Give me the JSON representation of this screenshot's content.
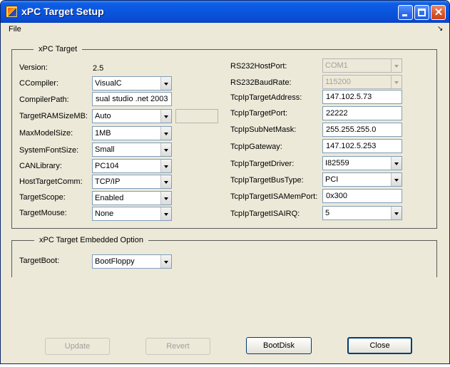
{
  "window": {
    "title": "xPC Target Setup"
  },
  "menu": {
    "file": "File",
    "overflow": "↘"
  },
  "main_group": {
    "title": "xPC Target",
    "left": {
      "version_label": "Version:",
      "version_value": "2.5",
      "ccompiler_label": "CCompiler:",
      "ccompiler_value": "VisualC",
      "compilerpath_label": "CompilerPath:",
      "compilerpath_value": "sual studio .net 2003",
      "ramsize_label": "TargetRAMSizeMB:",
      "ramsize_value": "Auto",
      "maxmodelsize_label": "MaxModelSize:",
      "maxmodelsize_value": "1MB",
      "systemfontsize_label": "SystemFontSize:",
      "systemfontsize_value": "Small",
      "canlibrary_label": "CANLibrary:",
      "canlibrary_value": "PC104",
      "hosttargetcomm_label": "HostTargetComm:",
      "hosttargetcomm_value": "TCP/IP",
      "targetscope_label": "TargetScope:",
      "targetscope_value": "Enabled",
      "targetmouse_label": "TargetMouse:",
      "targetmouse_value": "None"
    },
    "right": {
      "rs232hostport_label": "RS232HostPort:",
      "rs232hostport_value": "COM1",
      "rs232baudrate_label": "RS232BaudRate:",
      "rs232baudrate_value": "115200",
      "tcpiptargetaddress_label": "TcpIpTargetAddress:",
      "tcpiptargetaddress_value": "147.102.5.73",
      "tcpiptargetport_label": "TcpIpTargetPort:",
      "tcpiptargetport_value": "22222",
      "tcpipsubnetmask_label": "TcpIpSubNetMask:",
      "tcpipsubnetmask_value": "255.255.255.0",
      "tcpipgateway_label": "TcpIpGateway:",
      "tcpipgateway_value": "147.102.5.253",
      "tcpiptargetdriver_label": "TcpIpTargetDriver:",
      "tcpiptargetdriver_value": "I82559",
      "tcpiptargetbustype_label": "TcpIpTargetBusType:",
      "tcpiptargetbustype_value": "PCI",
      "tcpiptargetisamemport_label": "TcpIpTargetISAMemPort:",
      "tcpiptargetisamemport_value": "0x300",
      "tcpiptargetisairq_label": "TcpIpTargetISAIRQ:",
      "tcpiptargetisairq_value": "5"
    }
  },
  "embedded_group": {
    "title": "xPC Target Embedded Option",
    "targetboot_label": "TargetBoot:",
    "targetboot_value": "BootFloppy"
  },
  "buttons": {
    "update": "Update",
    "revert": "Revert",
    "bootdisk": "BootDisk",
    "close": "Close"
  }
}
